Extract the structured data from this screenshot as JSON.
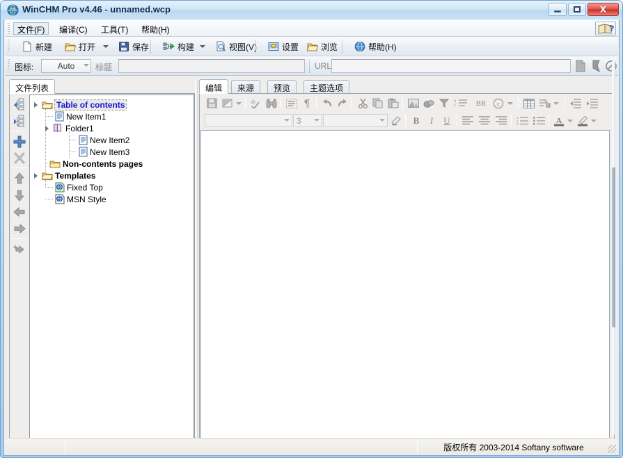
{
  "window": {
    "title": "WinCHM Pro v4.46 - unnamed.wcp",
    "app_icon": "question-globe-icon",
    "buttons": {
      "minimize": "Minimize",
      "maximize": "Maximize",
      "close": "Close",
      "close_glyph": "X"
    }
  },
  "menu": {
    "items": [
      {
        "label": "文件(F)",
        "name": "menu-file",
        "selected": true
      },
      {
        "label": "编译(C)",
        "name": "menu-compile",
        "selected": false
      },
      {
        "label": "工具(T)",
        "name": "menu-tools",
        "selected": false
      },
      {
        "label": "帮助(H)",
        "name": "menu-help",
        "selected": false
      }
    ],
    "help_button": "help-book-icon"
  },
  "toolbar": {
    "items": [
      {
        "label": "新建",
        "icon": "new-page-icon",
        "dropdown": false
      },
      {
        "label": "打开",
        "icon": "open-folder-icon",
        "dropdown": true
      },
      {
        "label": "保存",
        "icon": "save-disk-icon",
        "dropdown": false
      },
      {
        "label": "构建",
        "icon": "build-icon",
        "dropdown": true
      },
      {
        "label": "视图(V)",
        "icon": "view-magnifier-icon",
        "dropdown": false
      },
      {
        "label": "设置",
        "icon": "settings-icon",
        "dropdown": false
      },
      {
        "label": "浏览",
        "icon": "browse-folder-icon",
        "dropdown": false
      },
      {
        "label": "帮助(H)",
        "icon": "help-circle-icon",
        "dropdown": false
      }
    ]
  },
  "property_row": {
    "icon_label": "图标:",
    "icon_value": "Auto",
    "title_label": "标题",
    "title_value": "",
    "url_label": "URL",
    "url_value": "",
    "end_icons": [
      "page-icon",
      "bookmark-icon",
      "no-entry-icon"
    ]
  },
  "left_panel": {
    "tabs": [
      {
        "label": "文件列表",
        "active": true
      }
    ],
    "vertical_toolbar": [
      {
        "name": "expand-all-icon"
      },
      {
        "name": "collapse-all-icon"
      },
      {
        "name": "add-item-icon"
      },
      {
        "name": "delete-item-icon"
      },
      {
        "name": "move-up-icon"
      },
      {
        "name": "move-down-icon"
      },
      {
        "name": "move-left-icon"
      },
      {
        "name": "move-right-icon"
      },
      {
        "name": "move-to-icon"
      }
    ],
    "tree": [
      {
        "label": "Table of contents",
        "icon": "open-folder-yellow-icon",
        "depth": 0,
        "expander": "expanded",
        "style": "heading-blue",
        "selected": true
      },
      {
        "label": "New Item1",
        "icon": "document-page-icon",
        "depth": 1,
        "expander": "none",
        "style": "normal",
        "selected": false
      },
      {
        "label": "Folder1",
        "icon": "folder-book-icon",
        "depth": 1,
        "expander": "expanded",
        "style": "normal",
        "selected": false
      },
      {
        "label": "New Item2",
        "icon": "document-page-icon",
        "depth": 2,
        "expander": "none",
        "style": "normal",
        "selected": false
      },
      {
        "label": "New Item3",
        "icon": "document-page-icon",
        "depth": 2,
        "expander": "none",
        "style": "normal",
        "selected": false
      },
      {
        "label": "Non-contents pages",
        "icon": "closed-folder-yellow-icon",
        "depth": 0,
        "expander": "none",
        "style": "heading-black",
        "selected": false
      },
      {
        "label": "Templates",
        "icon": "open-folder-yellow-icon",
        "depth": 0,
        "expander": "expanded",
        "style": "heading-black",
        "selected": false
      },
      {
        "label": "Fixed Top",
        "icon": "template-globe-icon",
        "depth": 1,
        "expander": "none",
        "style": "normal",
        "selected": false
      },
      {
        "label": "MSN Style",
        "icon": "template-globe-icon",
        "depth": 1,
        "expander": "none",
        "style": "normal",
        "selected": false
      }
    ]
  },
  "right_panel": {
    "tabs": [
      {
        "label": "编辑",
        "active": true
      },
      {
        "label": "来源",
        "active": false
      },
      {
        "label": "预览",
        "active": false
      },
      {
        "label": "主题选项",
        "active": false
      }
    ],
    "editor_toolbar_row1": [
      {
        "name": "save-icon"
      },
      {
        "name": "edit-mode-icon",
        "dropdown": true
      },
      {
        "name": "sep"
      },
      {
        "name": "spellcheck-icon"
      },
      {
        "name": "find-binoculars-icon"
      },
      {
        "name": "sep"
      },
      {
        "name": "show-borders-icon"
      },
      {
        "name": "paragraph-marks-icon"
      },
      {
        "name": "sep"
      },
      {
        "name": "undo-icon"
      },
      {
        "name": "redo-icon"
      },
      {
        "name": "sep"
      },
      {
        "name": "cut-icon"
      },
      {
        "name": "copy-icon"
      },
      {
        "name": "paste-icon"
      },
      {
        "name": "sep"
      },
      {
        "name": "insert-image-icon"
      },
      {
        "name": "insert-object-icon"
      },
      {
        "name": "insert-flash-icon"
      },
      {
        "name": "insert-list-icon"
      },
      {
        "name": "insert-br-icon",
        "text": "BR"
      },
      {
        "name": "insert-symbol-icon",
        "dropdown": true
      },
      {
        "name": "sep"
      },
      {
        "name": "insert-table-icon"
      },
      {
        "name": "insert-hyperlink-icon",
        "dropdown": true
      },
      {
        "name": "sep"
      },
      {
        "name": "decrease-indent-icon"
      },
      {
        "name": "increase-indent-icon"
      }
    ],
    "editor_toolbar_row2": {
      "font_family": "",
      "font_size": "3",
      "style_value": "",
      "eraser": "clear-format-icon",
      "bold": "B",
      "italic": "I",
      "underline": "U",
      "align_left": "align-left-icon",
      "align_center": "align-center-icon",
      "align_right": "align-right-icon",
      "ordered_list": "ordered-list-icon",
      "unordered_list": "unordered-list-icon",
      "font_color": "A",
      "highlight_color": "highlight-icon"
    },
    "editor_content": ""
  },
  "status_bar": {
    "copyright": "版权所有 2003-2014 Softany software"
  },
  "colors": {
    "title_text": "#0b2f53",
    "toc_heading": "#1414d0",
    "window_frame": "#7ca7cd",
    "close_button": "#cc2f26",
    "panel_bg": "#f0eeec"
  }
}
